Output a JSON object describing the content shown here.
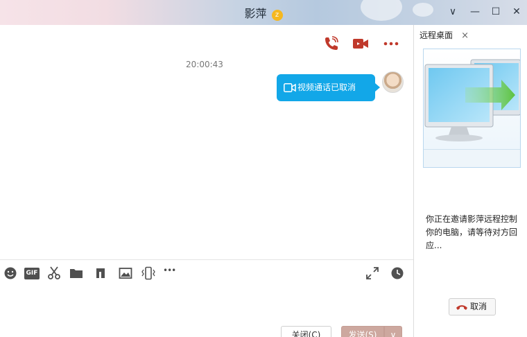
{
  "window": {
    "title": "影萍",
    "badge_glyph": "z",
    "minimize_glyph": "—",
    "maximize_glyph": "☐",
    "close_glyph": "✕",
    "collapse_glyph": "∨"
  },
  "chat": {
    "timestamp": "20:00:43",
    "message_text": "视频通话已取消",
    "accent_color": "#12a7e8",
    "icon_color": "#c0392b"
  },
  "toolbar": {
    "icons": [
      "emoji-icon",
      "gif-icon",
      "scissors-icon",
      "folder-icon",
      "music-icon",
      "image-icon",
      "shake-icon",
      "more-icon",
      "expand-icon",
      "history-clock-icon"
    ],
    "gif_label": "GIF",
    "more_glyph": "•••"
  },
  "footer": {
    "close_label": "关闭(C)",
    "send_label": "发送(S)",
    "send_arrow": "∨"
  },
  "panel": {
    "tab_label": "远程桌面",
    "tab_close": "×",
    "description": "你正在邀请影萍远程控制你的电脑，请等待对方回应...",
    "cancel_label": "取消"
  }
}
